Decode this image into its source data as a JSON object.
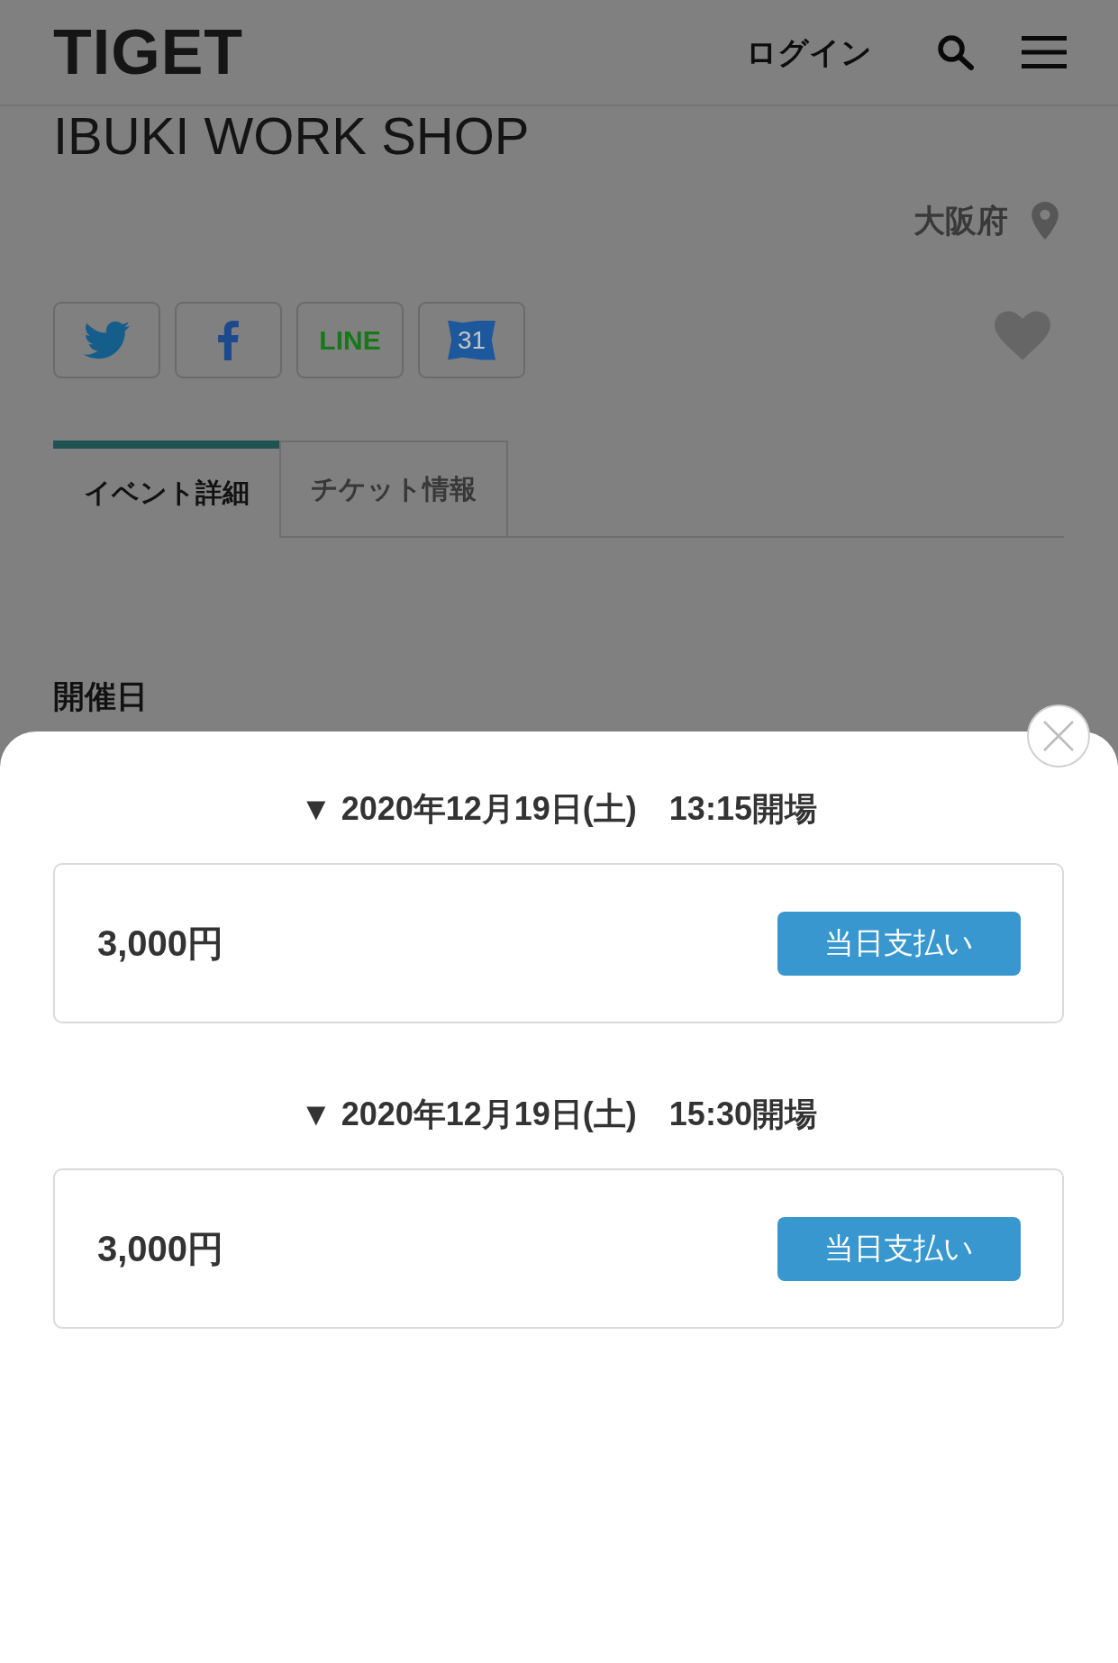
{
  "header": {
    "logo": "TIGET",
    "login": "ログイン"
  },
  "event": {
    "title": "IBUKI WORK SHOP",
    "location": "大阪府",
    "share_buttons": [
      {
        "kind": "twitter"
      },
      {
        "kind": "facebook"
      },
      {
        "kind": "line",
        "label": "LINE"
      },
      {
        "kind": "calendar",
        "label": "31"
      }
    ]
  },
  "tabs": [
    {
      "label": "イベント詳細",
      "selected": true
    },
    {
      "label": "チケット情報",
      "selected": false
    }
  ],
  "section": {
    "heading": "開催日"
  },
  "ticket_sheet": {
    "sessions": [
      {
        "heading": "▼ 2020年12月19日(土)　13:15開場",
        "tickets": [
          {
            "price": "3,000円",
            "button": "当日支払い"
          }
        ]
      },
      {
        "heading": "▼ 2020年12月19日(土)　15:30開場",
        "tickets": [
          {
            "price": "3,000円",
            "button": "当日支払い"
          }
        ]
      }
    ]
  }
}
